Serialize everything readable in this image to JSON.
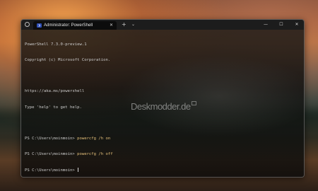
{
  "window": {
    "tab": {
      "label": "Administrator: PowerShell",
      "close_glyph": "✕",
      "icon": "powershell-icon"
    },
    "new_tab_glyph": "+",
    "dropdown_glyph": "⌄",
    "controls": {
      "minimize_glyph": "—",
      "maximize_glyph": "☐",
      "close_glyph": "✕"
    }
  },
  "terminal": {
    "banner": [
      "PowerShell 7.3.0-preview.1",
      "Copyright (c) Microsoft Corporation.",
      "",
      "https://aka.ms/powershell",
      "Type 'help' to get help.",
      ""
    ],
    "prompts": [
      {
        "prompt": "PS C:\\Users\\moinmoin> ",
        "command": "powercfg /h on"
      },
      {
        "prompt": "PS C:\\Users\\moinmoin> ",
        "command": "powercfg /h off"
      },
      {
        "prompt": "PS C:\\Users\\moinmoin> ",
        "command": ""
      }
    ]
  },
  "watermark": {
    "text": "Deskmodder.de"
  },
  "colors": {
    "titlebar": "#1c1c1c",
    "terminal_text": "#cccccc",
    "command_text": "#e5c07b",
    "tab_icon": "#2f4fb5"
  }
}
